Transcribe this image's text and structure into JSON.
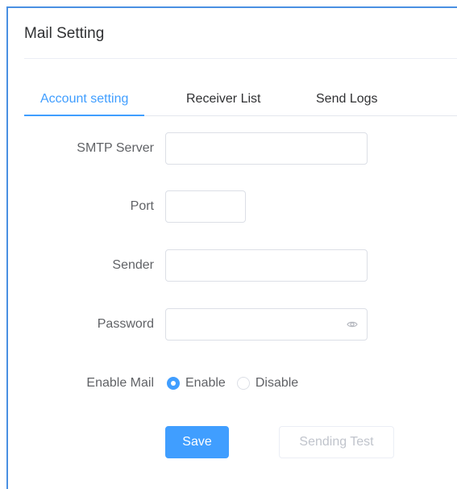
{
  "panel": {
    "title": "Mail Setting"
  },
  "tabs": [
    {
      "label": "Account setting",
      "active": true
    },
    {
      "label": "Receiver List",
      "active": false
    },
    {
      "label": "Send Logs",
      "active": false
    }
  ],
  "form": {
    "smtp_server": {
      "label": "SMTP Server",
      "value": ""
    },
    "port": {
      "label": "Port",
      "value": ""
    },
    "sender": {
      "label": "Sender",
      "value": ""
    },
    "password": {
      "label": "Password",
      "value": "",
      "icon": "eye-icon"
    },
    "enable_mail": {
      "label": "Enable Mail",
      "options": [
        {
          "label": "Enable",
          "checked": true
        },
        {
          "label": "Disable",
          "checked": false
        }
      ]
    }
  },
  "actions": {
    "save_label": "Save",
    "test_label": "Sending Test"
  },
  "colors": {
    "accent": "#409eff",
    "panel_border": "#4a90e2"
  }
}
